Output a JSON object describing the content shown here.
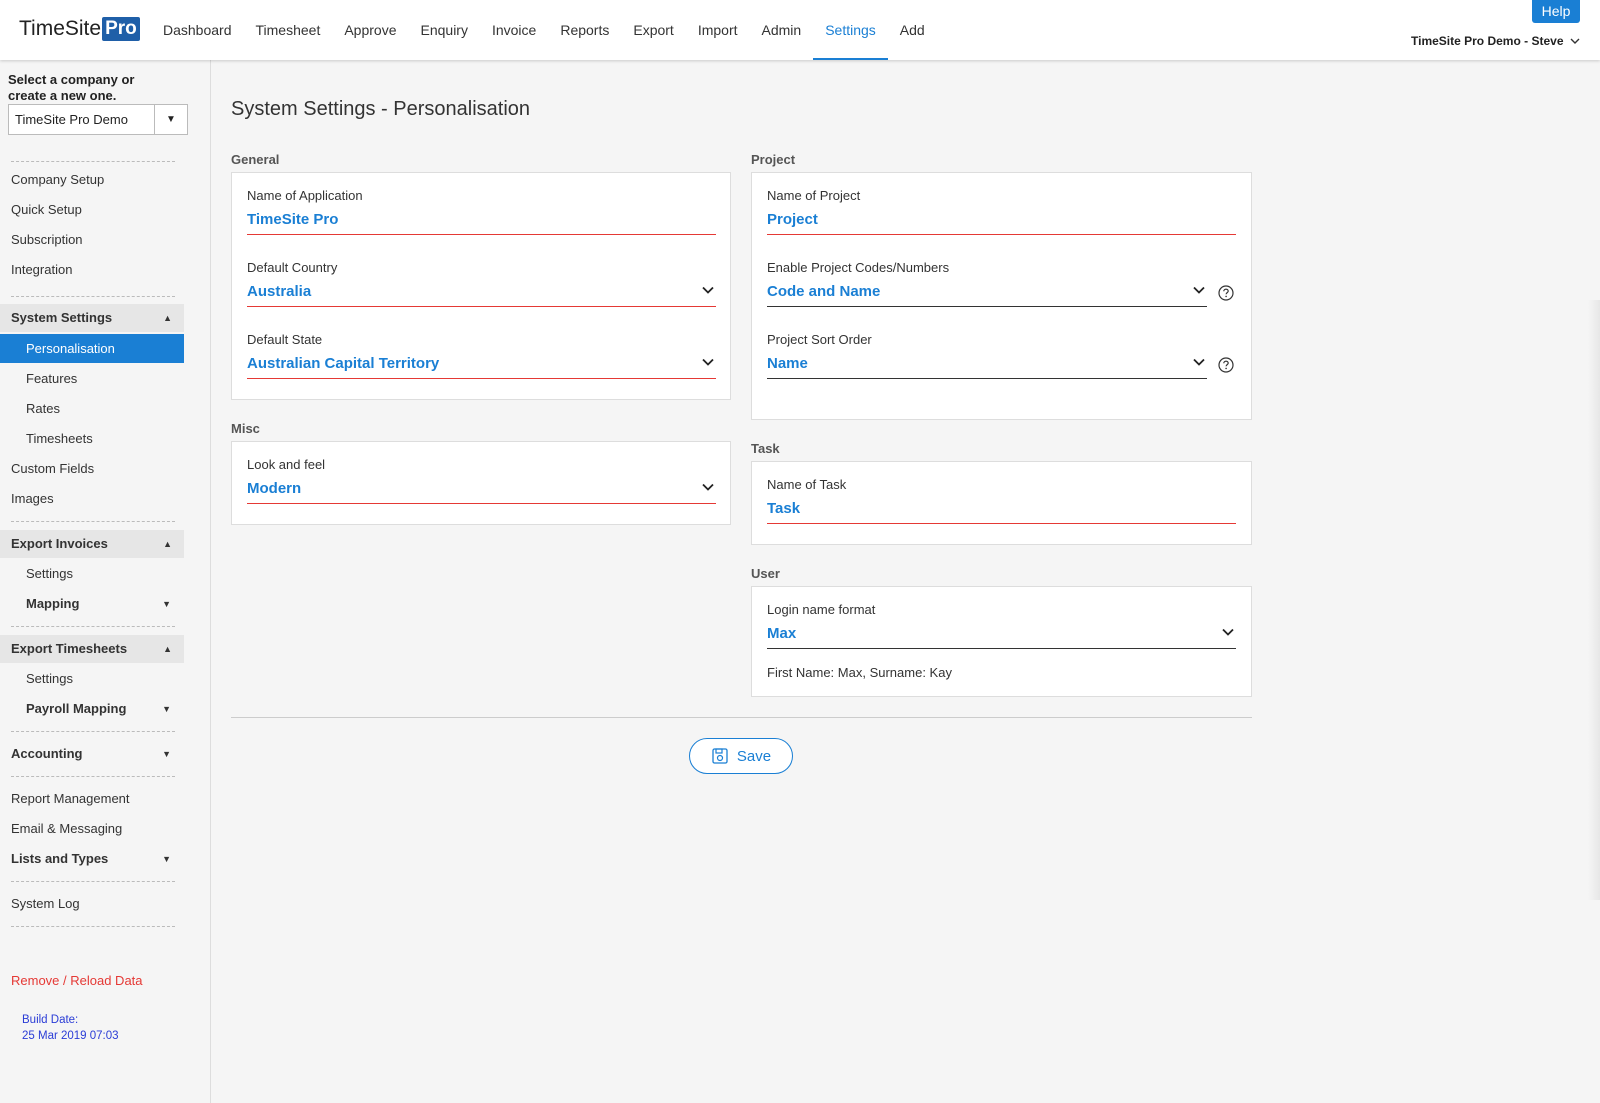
{
  "app": {
    "logo_text": "TimeSite",
    "logo_badge": "Pro"
  },
  "nav": {
    "items": [
      {
        "label": "Dashboard"
      },
      {
        "label": "Timesheet"
      },
      {
        "label": "Approve"
      },
      {
        "label": "Enquiry"
      },
      {
        "label": "Invoice"
      },
      {
        "label": "Reports"
      },
      {
        "label": "Export"
      },
      {
        "label": "Import"
      },
      {
        "label": "Admin"
      },
      {
        "label": "Settings"
      },
      {
        "label": "Add"
      }
    ],
    "active": "Settings",
    "help_label": "Help",
    "user_label": "TimeSite Pro Demo - Steve"
  },
  "sidebar": {
    "company_prompt": "Select a company or create a new one.",
    "company_selected": "TimeSite Pro Demo",
    "company_setup": "Company Setup",
    "quick_setup": "Quick Setup",
    "subscription": "Subscription",
    "integration": "Integration",
    "system_settings": "System Settings",
    "personalisation": "Personalisation",
    "features": "Features",
    "rates": "Rates",
    "timesheets": "Timesheets",
    "custom_fields": "Custom Fields",
    "images": "Images",
    "export_invoices": "Export Invoices",
    "ei_settings": "Settings",
    "ei_mapping": "Mapping",
    "export_timesheets": "Export Timesheets",
    "et_settings": "Settings",
    "et_payroll_mapping": "Payroll Mapping",
    "accounting": "Accounting",
    "report_management": "Report Management",
    "email_messaging": "Email & Messaging",
    "lists_types": "Lists and Types",
    "system_log": "System Log",
    "remove_reload": "Remove / Reload Data",
    "build_label": "Build Date:",
    "build_date": "25 Mar 2019 07:03"
  },
  "main": {
    "title": "System Settings - Personalisation",
    "general": {
      "label": "General",
      "app_name_label": "Name of Application",
      "app_name_value": "TimeSite Pro",
      "country_label": "Default Country",
      "country_value": "Australia",
      "state_label": "Default State",
      "state_value": "Australian Capital Territory"
    },
    "misc": {
      "label": "Misc",
      "look_label": "Look and feel",
      "look_value": "Modern"
    },
    "project": {
      "label": "Project",
      "name_label": "Name of Project",
      "name_value": "Project",
      "codes_label": "Enable Project Codes/Numbers",
      "codes_value": "Code and Name",
      "sort_label": "Project Sort Order",
      "sort_value": "Name"
    },
    "task": {
      "label": "Task",
      "name_label": "Name of Task",
      "name_value": "Task"
    },
    "user": {
      "label": "User",
      "login_label": "Login name format",
      "login_value": "Max",
      "login_hint": "First Name: Max, Surname: Kay"
    },
    "save_label": "Save"
  },
  "colors": {
    "accent": "#1a7fd4",
    "error_underline": "#e53935",
    "logo_badge": "#1f5fa8"
  }
}
